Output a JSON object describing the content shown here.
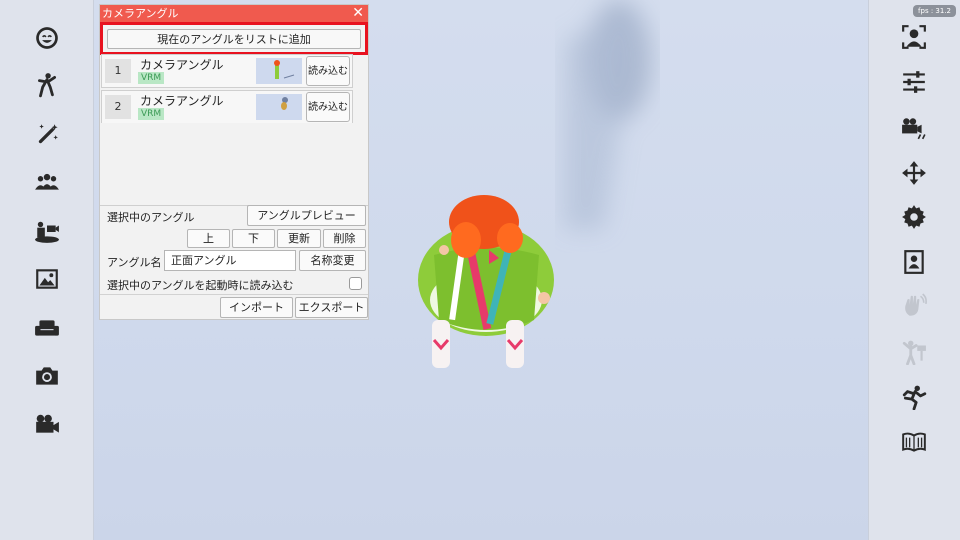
{
  "fps": "fps : 31.2",
  "left_sidebar": [
    "face-icon",
    "pose-icon",
    "magic-wand-icon",
    "people-icon",
    "camera-stage-icon",
    "image-icon",
    "sofa-icon",
    "camera-icon",
    "video-camera-icon"
  ],
  "right_sidebar": [
    "face-tracking-icon",
    "sliders-icon",
    "video-settings-icon",
    "move-icon",
    "gear-icon",
    "portrait-icon",
    "hand-gesture-icon",
    "pose-guide-icon",
    "running-icon",
    "book-icon"
  ],
  "panel": {
    "title": "カメラアングル",
    "close": "✕",
    "add_button": "現在のアングルをリストに追加",
    "angles": [
      {
        "number": "1",
        "name": "カメラアングル",
        "badge": "VRM",
        "load": "読み込む"
      },
      {
        "number": "2",
        "name": "カメラアングル",
        "badge": "VRM",
        "load": "読み込む"
      }
    ],
    "selected_label": "選択中のアングル",
    "preview_button": "アングルプレビュー",
    "up_button": "上",
    "down_button": "下",
    "update_button": "更新",
    "delete_button": "削除",
    "name_label": "アングル名",
    "name_value": "正面アングル",
    "rename_button": "名称変更",
    "startup_label": "選択中のアングルを起動時に読み込む",
    "import_button": "インポート",
    "export_button": "エクスポート"
  },
  "colors": {
    "title_bar": "#f05a4e",
    "highlight": "#e8121f",
    "badge_bg": "#b9e7c5",
    "badge_fg": "#3b9a55"
  }
}
